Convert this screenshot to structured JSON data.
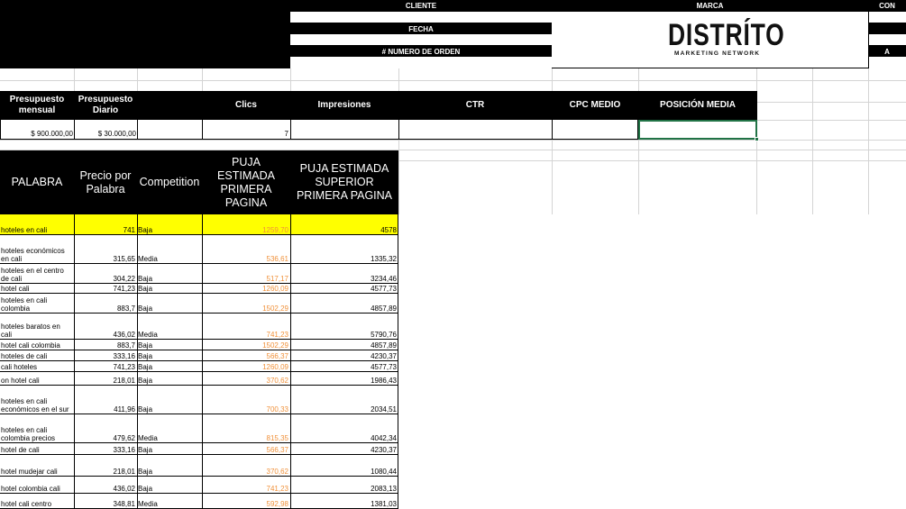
{
  "header": {
    "cliente_label": "CLIENTE",
    "fecha_label": "FECHA",
    "orden_label": "# NUMERO DE ORDEN",
    "marca_label": "MARCA",
    "right_label_top": "CON",
    "right_label_bottom": "A",
    "logo_name": "DISTRÍTO",
    "logo_tagline": "MARKETING NETWORK"
  },
  "metrics": {
    "headers": [
      "Presupuesto mensual",
      "Presupuesto Diario",
      "Clics",
      "Impresiones",
      "CTR",
      "CPC MEDIO",
      "POSICIÓN MEDIA"
    ],
    "values": {
      "presupuesto_mensual": "$ 900.000,00",
      "presupuesto_diario": "$ 30.000,00",
      "clics": "7"
    }
  },
  "keywords": {
    "headers": [
      "PALABRA",
      "Precio por Palabra",
      "Competition",
      "PUJA ESTIMADA PRIMERA PAGINA",
      "PUJA ESTIMADA SUPERIOR PRIMERA PAGINA"
    ],
    "rows": [
      {
        "palabra": "hoteles en cali",
        "precio": "741",
        "competition": "Baja",
        "puja": "1259,70",
        "superior": "4578"
      },
      {
        "palabra": "hoteles económicos en cali",
        "precio": "315,65",
        "competition": "Media",
        "puja": "536,61",
        "superior": "1335,32"
      },
      {
        "palabra": "hoteles en el centro de cali",
        "precio": "304,22",
        "competition": "Baja",
        "puja": "517,17",
        "superior": "3234,46"
      },
      {
        "palabra": "hotel cali",
        "precio": "741,23",
        "competition": "Baja",
        "puja": "1260,09",
        "superior": "4577,73"
      },
      {
        "palabra": "hoteles en cali colombia",
        "precio": "883,7",
        "competition": "Baja",
        "puja": "1502,29",
        "superior": "4857,89"
      },
      {
        "palabra": "hoteles baratos en cali",
        "precio": "436,02",
        "competition": "Media",
        "puja": "741,23",
        "superior": "5790,76"
      },
      {
        "palabra": "hotel cali colombia",
        "precio": "883,7",
        "competition": "Baja",
        "puja": "1502,29",
        "superior": "4857,89"
      },
      {
        "palabra": "hoteles de cali",
        "precio": "333,16",
        "competition": "Baja",
        "puja": "566,37",
        "superior": "4230,37"
      },
      {
        "palabra": "cali hoteles",
        "precio": "741,23",
        "competition": "Baja",
        "puja": "1260,09",
        "superior": "4577,73"
      },
      {
        "palabra": "on hotel cali",
        "precio": "218,01",
        "competition": "Baja",
        "puja": "370,62",
        "superior": "1986,43"
      },
      {
        "palabra": "hoteles en cali económicos en el sur",
        "precio": "411,96",
        "competition": "Baja",
        "puja": "700,33",
        "superior": "2034,51"
      },
      {
        "palabra": "hoteles en cali colombia precios",
        "precio": "479,62",
        "competition": "Media",
        "puja": "815,35",
        "superior": "4042,34"
      },
      {
        "palabra": "hotel de cali",
        "precio": "333,16",
        "competition": "Baja",
        "puja": "566,37",
        "superior": "4230,37"
      },
      {
        "palabra": "hotel mudejar cali",
        "precio": "218,01",
        "competition": "Baja",
        "puja": "370,62",
        "superior": "1080,44"
      },
      {
        "palabra": "hotel colombia cali",
        "precio": "436,02",
        "competition": "Baja",
        "puja": "741,23",
        "superior": "2083,13"
      },
      {
        "palabra": "hotel cali centro",
        "precio": "348,81",
        "competition": "Media",
        "puja": "592,98",
        "superior": "1381,03"
      }
    ]
  },
  "colors": {
    "header_bg": "#000000",
    "highlight_row": "#ffff00",
    "puja_text": "#f0913a",
    "selection_border": "#217346",
    "gridline": "#d4d4d4"
  }
}
